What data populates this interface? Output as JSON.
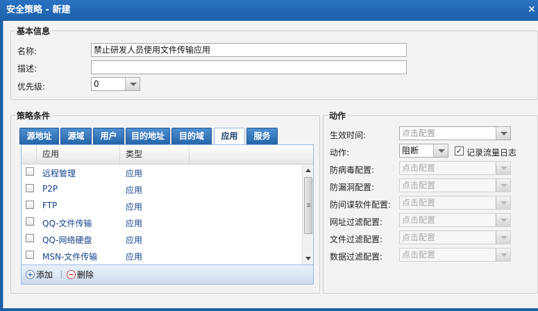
{
  "window": {
    "title": "安全策略 - 新建"
  },
  "basic": {
    "legend": "基本信息",
    "name_label": "名称:",
    "name_value": "禁止研发人员使用文件传输应用",
    "desc_label": "描述:",
    "desc_value": "",
    "priority_label": "优先级:",
    "priority_value": "0"
  },
  "conditions": {
    "legend": "策略条件",
    "tabs": [
      "源地址",
      "源域",
      "用户",
      "目的地址",
      "目的域",
      "应用",
      "服务"
    ],
    "active_tab": "应用",
    "columns": [
      "应用",
      "类型"
    ],
    "rows": [
      {
        "name": "远程管理",
        "type": "应用"
      },
      {
        "name": "P2P",
        "type": "应用"
      },
      {
        "name": "FTP",
        "type": "应用"
      },
      {
        "name": "QQ-文件传输",
        "type": "应用"
      },
      {
        "name": "QQ-网络硬盘",
        "type": "应用"
      },
      {
        "name": "MSN-文件传输",
        "type": "应用"
      }
    ],
    "add_label": "添加",
    "delete_label": "删除"
  },
  "action": {
    "legend": "动作",
    "effective_time_label": "生效时间:",
    "effective_time_placeholder": "点击配置",
    "action_label": "动作:",
    "action_value": "阻断",
    "log_label": "记录流量日志",
    "log_checked": true,
    "antivirus_label": "防病毒配置:",
    "vuln_label": "防漏洞配置:",
    "spyware_label": "防间谍软件配置:",
    "url_filter_label": "网址过滤配置:",
    "file_filter_label": "文件过滤配置:",
    "data_filter_label": "数据过滤配置:",
    "config_placeholder": "点击配置"
  },
  "colors": {
    "title_bar": "#1b5fa8",
    "tab": "#2f73b8",
    "link_text": "#15428b"
  }
}
